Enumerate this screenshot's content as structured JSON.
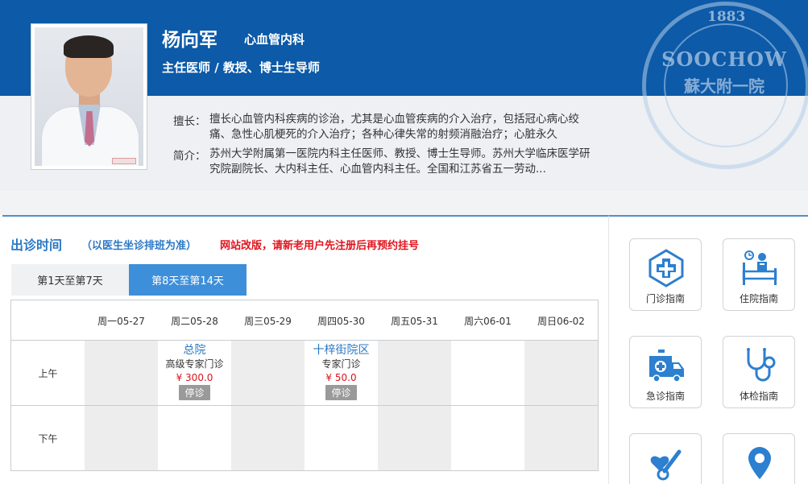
{
  "header": {
    "seal": {
      "year": "1883",
      "text": "SOOCHOW",
      "text2": "蘇大附一院"
    }
  },
  "doctor": {
    "name": "杨向军",
    "department": "心血管内科",
    "title": "主任医师 / 教授、博士生导师",
    "specialty_label": "擅长：",
    "specialty_text": "擅长心血管内科疾病的诊治，尤其是心血管疾病的介入治疗，包括冠心病心绞痛、急性心肌梗死的介入治疗；各种心律失常的射频消融治疗；心脏永久",
    "intro_label": "简介：",
    "intro_text": "苏州大学附属第一医院内科主任医师、教授、博士生导师。苏州大学临床医学研究院副院长、大内科主任、心血管内科主任。全国和江苏省五一劳动..."
  },
  "schedule": {
    "title": "出诊时间",
    "subtitle": "（以医生坐诊排班为准）",
    "notice": "网站改版，请新老用户先注册后再预约挂号",
    "tabs": [
      {
        "label": "第1天至第7天",
        "active": false
      },
      {
        "label": "第8天至第14天",
        "active": true
      }
    ],
    "days": [
      "周一05-27",
      "周二05-28",
      "周三05-29",
      "周四05-30",
      "周五05-31",
      "周六06-01",
      "周日06-02"
    ],
    "am_label": "上午",
    "pm_label": "下午",
    "am_slots": [
      null,
      {
        "location": "总院",
        "type": "高级专家门诊",
        "price": "¥ 300.0",
        "status": "停诊"
      },
      null,
      {
        "location": "十梓街院区",
        "type": "专家门诊",
        "price": "¥ 50.0",
        "status": "停诊"
      },
      null,
      null,
      null
    ],
    "pm_slots": [
      null,
      null,
      null,
      null,
      null,
      null,
      null
    ]
  },
  "guides": [
    {
      "label": "门诊指南",
      "icon": "outpatient-cross-icon"
    },
    {
      "label": "住院指南",
      "icon": "hospital-bed-icon"
    },
    {
      "label": "急诊指南",
      "icon": "ambulance-icon"
    },
    {
      "label": "体检指南",
      "icon": "stethoscope-icon"
    },
    {
      "label": "",
      "icon": "heart-thermometer-icon"
    },
    {
      "label": "",
      "icon": "location-pin-icon"
    }
  ],
  "colors": {
    "brand_blue": "#0c5aa8",
    "accent_blue": "#2b78c5",
    "tab_active": "#3d8fd9",
    "notice_red": "#e0141e",
    "icon_blue": "#2d7fd0"
  }
}
